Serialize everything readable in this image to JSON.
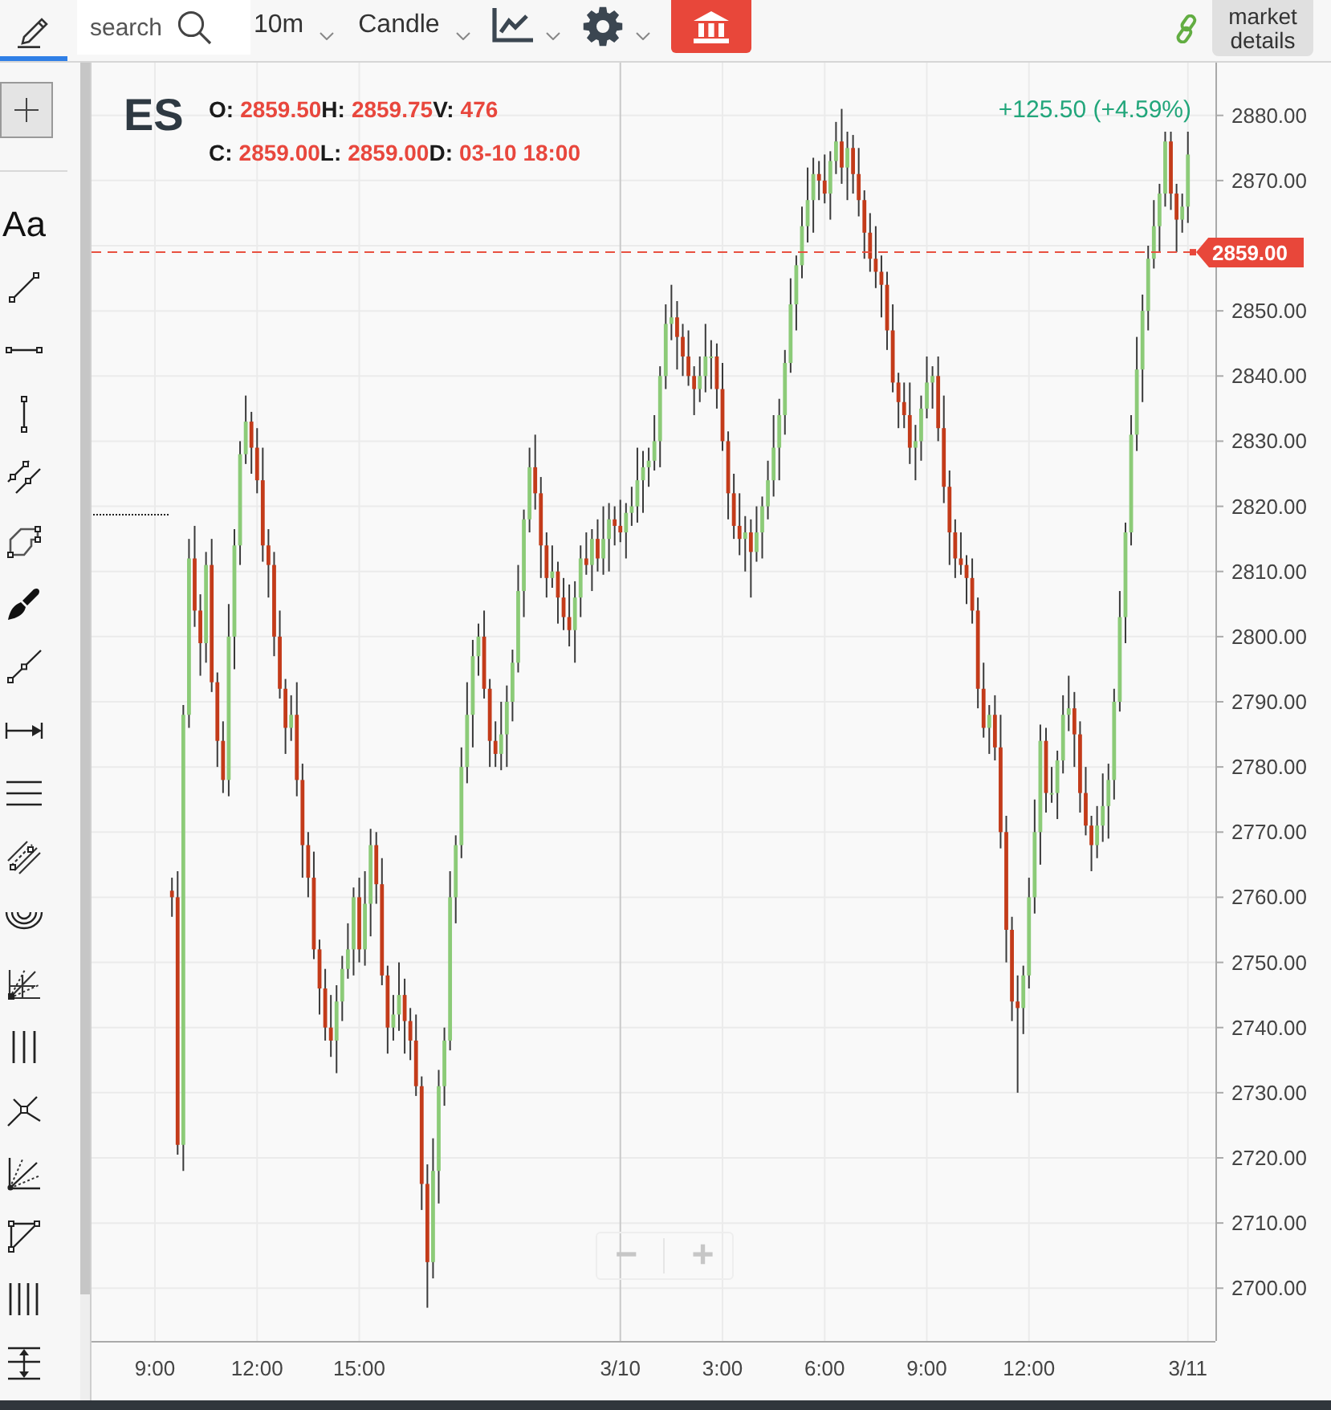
{
  "toolbar": {
    "draw_tab": {
      "selected": true
    },
    "search": {
      "placeholder": "search"
    },
    "interval": {
      "value": "10m"
    },
    "chart_style": {
      "value": "Candle"
    },
    "market_details": {
      "label": "market details"
    }
  },
  "pointer_tools": [
    {
      "kind": "crosshair",
      "selected": true
    }
  ],
  "drawing_tools": [
    {
      "kind": "text",
      "label": "Aa",
      "selected": false
    },
    {
      "kind": "segment",
      "selected": false
    },
    {
      "kind": "horizontal-segment",
      "selected": false
    },
    {
      "kind": "vertical-segment",
      "selected": false
    },
    {
      "kind": "channel",
      "selected": false
    },
    {
      "kind": "polygon",
      "selected": false
    },
    {
      "kind": "brush",
      "selected": false
    },
    {
      "kind": "ray",
      "selected": false
    },
    {
      "kind": "measure",
      "selected": false
    },
    {
      "kind": "horizontal-lines",
      "selected": false
    },
    {
      "kind": "hatched-channel",
      "selected": false
    },
    {
      "kind": "arcs",
      "selected": false
    },
    {
      "kind": "grid",
      "selected": false
    },
    {
      "kind": "three-lines",
      "selected": false
    },
    {
      "kind": "pitchfork",
      "selected": false
    },
    {
      "kind": "fan",
      "selected": false
    },
    {
      "kind": "triangle",
      "selected": false
    },
    {
      "kind": "four-lines",
      "selected": false
    },
    {
      "kind": "range",
      "selected": false
    }
  ],
  "chart": {
    "symbol": "ES",
    "quote_rows": [
      [
        {
          "label": "O:",
          "value": "2859.50"
        },
        {
          "label": "H:",
          "value": "2859.75"
        },
        {
          "label": "V:",
          "value": "476"
        }
      ],
      [
        {
          "label": "C:",
          "value": "2859.00"
        },
        {
          "label": "L:",
          "value": "2859.00"
        },
        {
          "label": "D:",
          "value": "03-10 18:00"
        }
      ]
    ],
    "change": "+125.50 (+4.59%)",
    "chart_data": {
      "type": "candlestick",
      "categories": [
        "9:00",
        null,
        null,
        null,
        null,
        null,
        null,
        null,
        null,
        null,
        null,
        null,
        null,
        null,
        null,
        null,
        null,
        null,
        "12:00",
        null,
        null,
        null,
        null,
        null,
        null,
        null,
        null,
        null,
        null,
        null,
        null,
        null,
        null,
        null,
        null,
        null,
        "15:00",
        null,
        null,
        null,
        null,
        null,
        null,
        null,
        null,
        null,
        null,
        null,
        null,
        null,
        null,
        null,
        null,
        null,
        null,
        null,
        null,
        null,
        null,
        null,
        null,
        null,
        null,
        null,
        null,
        null,
        null,
        null,
        null,
        null,
        null,
        null,
        null,
        null,
        null,
        null,
        null,
        null,
        null,
        null,
        null,
        null,
        "3/10",
        null,
        null,
        null,
        null,
        null,
        null,
        null,
        null,
        null,
        null,
        null,
        null,
        null,
        null,
        null,
        null,
        null,
        "3:00",
        null,
        null,
        null,
        null,
        null,
        null,
        null,
        null,
        null,
        null,
        null,
        null,
        null,
        null,
        null,
        null,
        null,
        "6:00",
        null,
        null,
        null,
        null,
        null,
        null,
        null,
        null,
        null,
        null,
        null,
        null,
        null,
        null,
        null,
        null,
        null,
        "9:00",
        null,
        null,
        null,
        null,
        null,
        null,
        null,
        null,
        null,
        null,
        null,
        null,
        null,
        null,
        null,
        null,
        null,
        "12:00",
        null,
        null,
        null,
        null,
        null,
        null,
        null,
        null,
        null,
        null,
        null,
        null,
        null,
        null,
        null,
        null,
        null,
        null,
        null,
        null,
        null,
        null,
        null,
        null,
        null,
        null,
        null,
        "3/11"
      ],
      "ohlc": [
        null,
        null,
        null,
        [
          2761,
          2763,
          2757,
          2760
        ],
        [
          2760,
          2764,
          2720.5,
          2722
        ],
        [
          2722,
          2789.5,
          2718,
          2788
        ],
        [
          2788,
          2815,
          2786,
          2812
        ],
        [
          2812,
          2817,
          2801.5,
          2804
        ],
        [
          2804,
          2806.5,
          2794,
          2799
        ],
        [
          2799,
          2813,
          2796,
          2811
        ],
        [
          2811,
          2815,
          2791.5,
          2793
        ],
        [
          2793,
          2794.5,
          2780,
          2784
        ],
        [
          2784,
          2787,
          2776,
          2778
        ],
        [
          2778,
          2805,
          2775.5,
          2800
        ],
        [
          2800,
          2816.5,
          2795,
          2814
        ],
        [
          2814,
          2830,
          2811,
          2828
        ],
        [
          2828,
          2837,
          2826.5,
          2833
        ],
        [
          2833,
          2834.5,
          2825,
          2829
        ],
        [
          2829,
          2832,
          2822,
          2824
        ],
        [
          2824,
          2829,
          2811.5,
          2814
        ],
        [
          2814,
          2816.5,
          2806,
          2811
        ],
        [
          2811,
          2813,
          2797,
          2800
        ],
        [
          2800,
          2804,
          2790.5,
          2792
        ],
        [
          2792,
          2793.5,
          2782,
          2786
        ],
        [
          2786,
          2791,
          2784,
          2788
        ],
        [
          2788,
          2793,
          2775.5,
          2778
        ],
        [
          2778,
          2780.5,
          2763,
          2768
        ],
        [
          2768,
          2770,
          2760,
          2763
        ],
        [
          2763,
          2767,
          2750.5,
          2752
        ],
        [
          2752,
          2753.5,
          2742,
          2746
        ],
        [
          2746,
          2749,
          2738,
          2740
        ],
        [
          2740,
          2745,
          2735.5,
          2738
        ],
        [
          2738,
          2746.5,
          2733,
          2744
        ],
        [
          2744,
          2751,
          2741,
          2749
        ],
        [
          2749,
          2756,
          2747.5,
          2752
        ],
        [
          2752,
          2761.5,
          2748,
          2760
        ],
        [
          2760,
          2763,
          2750,
          2752
        ],
        [
          2752,
          2764,
          2749.5,
          2759
        ],
        [
          2759,
          2770.5,
          2754,
          2768
        ],
        [
          2768,
          2770,
          2759,
          2762
        ],
        [
          2762,
          2766,
          2746.5,
          2748
        ],
        [
          2748,
          2749.5,
          2736,
          2740
        ],
        [
          2740,
          2745,
          2738,
          2742
        ],
        [
          2742,
          2750,
          2739.5,
          2745
        ],
        [
          2745,
          2747.5,
          2736,
          2741
        ],
        [
          2741,
          2743,
          2735,
          2738
        ],
        [
          2738,
          2742,
          2729.5,
          2731
        ],
        [
          2731,
          2732.5,
          2712,
          2716
        ],
        [
          2716,
          2719,
          2697,
          2704
        ],
        [
          2704,
          2723,
          2701.5,
          2718
        ],
        [
          2718,
          2733.5,
          2713,
          2731
        ],
        [
          2731,
          2740,
          2728,
          2738
        ],
        [
          2738,
          2764,
          2736.5,
          2760
        ],
        [
          2760,
          2769.5,
          2756,
          2768
        ],
        [
          2768,
          2783,
          2766,
          2780
        ],
        [
          2780,
          2793,
          2777.5,
          2788
        ],
        [
          2788,
          2799.5,
          2783,
          2797
        ],
        [
          2797,
          2802,
          2794,
          2800
        ],
        [
          2800,
          2804,
          2790.5,
          2792
        ],
        [
          2792,
          2793.5,
          2780,
          2784
        ],
        [
          2784,
          2787,
          2780,
          2782
        ],
        [
          2782,
          2790,
          2779.5,
          2785
        ],
        [
          2785,
          2792.5,
          2780,
          2790
        ],
        [
          2790,
          2798,
          2787,
          2796
        ],
        [
          2796,
          2811,
          2794.5,
          2807
        ],
        [
          2807,
          2819.5,
          2803,
          2818
        ],
        [
          2818,
          2829,
          2816,
          2826
        ],
        [
          2826,
          2831,
          2819.5,
          2822
        ],
        [
          2822,
          2824.5,
          2809,
          2814
        ],
        [
          2814,
          2816,
          2806,
          2809
        ],
        [
          2809,
          2814,
          2807.5,
          2810
        ],
        [
          2810,
          2811.5,
          2802,
          2806
        ],
        [
          2806,
          2809,
          2801,
          2803
        ],
        [
          2803,
          2808,
          2798.5,
          2801
        ],
        [
          2801,
          2808.5,
          2796,
          2806
        ],
        [
          2806,
          2814,
          2803,
          2812
        ],
        [
          2812,
          2816,
          2809.5,
          2811
        ],
        [
          2811,
          2816.5,
          2807,
          2815
        ],
        [
          2815,
          2818,
          2810,
          2812
        ],
        [
          2812,
          2820,
          2809.5,
          2815
        ],
        [
          2815,
          2820.5,
          2810,
          2818
        ],
        [
          2818,
          2820,
          2814,
          2817
        ],
        [
          2817,
          2821,
          2814.5,
          2816
        ],
        [
          2816,
          2820.5,
          2812,
          2819
        ],
        [
          2819,
          2823,
          2817,
          2820
        ],
        [
          2820,
          2829,
          2817.5,
          2824
        ],
        [
          2824,
          2828.5,
          2819,
          2826
        ],
        [
          2826,
          2829,
          2823,
          2827
        ],
        [
          2827,
          2834,
          2825.5,
          2830
        ],
        [
          2830,
          2841.5,
          2826,
          2840
        ],
        [
          2840,
          2851,
          2838,
          2848
        ],
        [
          2848,
          2854,
          2845.5,
          2849
        ],
        [
          2849,
          2851.5,
          2841,
          2846
        ],
        [
          2846,
          2848,
          2840,
          2843
        ],
        [
          2843,
          2847,
          2838.5,
          2840
        ],
        [
          2840,
          2841.5,
          2834,
          2838
        ],
        [
          2838,
          2843,
          2836,
          2840
        ],
        [
          2840,
          2848,
          2837.5,
          2843
        ],
        [
          2843,
          2845.5,
          2838,
          2843
        ],
        [
          2843,
          2845,
          2835,
          2838
        ],
        [
          2838,
          2842,
          2828.5,
          2830
        ],
        [
          2830,
          2831.5,
          2818,
          2822
        ],
        [
          2822,
          2825,
          2815,
          2817
        ],
        [
          2817,
          2822,
          2812.5,
          2815
        ],
        [
          2815,
          2818.5,
          2810,
          2816
        ],
        [
          2816,
          2818,
          2806,
          2813
        ],
        [
          2813,
          2820,
          2811.5,
          2816
        ],
        [
          2816,
          2821.5,
          2812,
          2820
        ],
        [
          2820,
          2827,
          2818,
          2824
        ],
        [
          2824,
          2834,
          2821.5,
          2829
        ],
        [
          2829,
          2836.5,
          2824,
          2834
        ],
        [
          2834,
          2844,
          2831,
          2842
        ],
        [
          2842,
          2855,
          2840.5,
          2851
        ],
        [
          2851,
          2858.5,
          2847,
          2857
        ],
        [
          2857,
          2866,
          2855,
          2863
        ],
        [
          2863,
          2872,
          2860.5,
          2867
        ],
        [
          2867,
          2873.5,
          2862,
          2871
        ],
        [
          2871,
          2873,
          2867,
          2870
        ],
        [
          2870,
          2874,
          2866.5,
          2868
        ],
        [
          2868,
          2874.5,
          2864,
          2873
        ],
        [
          2873,
          2879,
          2871,
          2876
        ],
        [
          2876,
          2881,
          2869.5,
          2872
        ],
        [
          2872,
          2877.5,
          2867,
          2875
        ],
        [
          2875,
          2877,
          2868,
          2871
        ],
        [
          2871,
          2875,
          2864.5,
          2867
        ],
        [
          2867,
          2868.5,
          2858,
          2862
        ],
        [
          2862,
          2865,
          2856,
          2858
        ],
        [
          2858,
          2863,
          2853.5,
          2856
        ],
        [
          2856,
          2858.5,
          2849,
          2854
        ],
        [
          2854,
          2856,
          2844,
          2847
        ],
        [
          2847,
          2851,
          2837.5,
          2839
        ],
        [
          2839,
          2840.5,
          2832,
          2836
        ],
        [
          2836,
          2839,
          2832,
          2834
        ],
        [
          2834,
          2839,
          2826.5,
          2829
        ],
        [
          2829,
          2832.5,
          2824,
          2830
        ],
        [
          2830,
          2837,
          2827,
          2835
        ],
        [
          2835,
          2843,
          2833.5,
          2839
        ],
        [
          2839,
          2841.5,
          2835,
          2840
        ],
        [
          2840,
          2843,
          2830,
          2832
        ],
        [
          2832,
          2837,
          2820.5,
          2823
        ],
        [
          2823,
          2825.5,
          2811,
          2816
        ],
        [
          2816,
          2818,
          2809,
          2812
        ],
        [
          2812,
          2816,
          2809.5,
          2811
        ],
        [
          2811,
          2812.5,
          2805,
          2809
        ],
        [
          2809,
          2812,
          2802,
          2804
        ],
        [
          2804,
          2806,
          2789,
          2792
        ],
        [
          2792,
          2796,
          2784.5,
          2786
        ],
        [
          2786,
          2789.5,
          2782,
          2788
        ],
        [
          2788,
          2791,
          2781,
          2783
        ],
        [
          2783,
          2788,
          2767.5,
          2770
        ],
        [
          2770,
          2772.5,
          2750,
          2755
        ],
        [
          2755,
          2757,
          2741,
          2744
        ],
        [
          2744,
          2748,
          2730,
          2743
        ],
        [
          2743,
          2749.5,
          2739,
          2748
        ],
        [
          2748,
          2763,
          2746,
          2760
        ],
        [
          2760,
          2775,
          2757.5,
          2770
        ],
        [
          2770,
          2786.5,
          2765,
          2784
        ],
        [
          2784,
          2786,
          2773,
          2776
        ],
        [
          2776,
          2780,
          2774.5,
          2776
        ],
        [
          2776,
          2782.5,
          2772,
          2781
        ],
        [
          2781,
          2791,
          2779,
          2788
        ],
        [
          2788,
          2794,
          2785.5,
          2789
        ],
        [
          2789,
          2791.5,
          2780,
          2785
        ],
        [
          2785,
          2787,
          2773,
          2776
        ],
        [
          2776,
          2780,
          2769.5,
          2771
        ],
        [
          2771,
          2772.5,
          2764,
          2768
        ],
        [
          2768,
          2774,
          2766,
          2771
        ],
        [
          2771,
          2779,
          2768.5,
          2774
        ],
        [
          2774,
          2780.5,
          2769,
          2778
        ],
        [
          2778,
          2792,
          2775,
          2790
        ],
        [
          2790,
          2807,
          2788.5,
          2803
        ],
        [
          2803,
          2817.5,
          2799,
          2816
        ],
        [
          2816,
          2834,
          2814,
          2831
        ],
        [
          2831,
          2846,
          2828.5,
          2841
        ],
        [
          2841,
          2852.5,
          2836,
          2850
        ],
        [
          2850,
          2860,
          2847,
          2858
        ],
        [
          2858,
          2867,
          2856.5,
          2863
        ],
        [
          2863,
          2869.5,
          2859,
          2868
        ],
        [
          2868,
          2877.5,
          2866,
          2876
        ],
        [
          2876,
          2877.5,
          2865.5,
          2868
        ],
        [
          2868,
          2869.5,
          2859,
          2864
        ],
        [
          2864,
          2868,
          2862,
          2866
        ],
        [
          2866,
          2877.5,
          2863.5,
          2874
        ]
      ],
      "ylim": [
        2691.9,
        2888.1
      ],
      "yticks": [
        {
          "value": 2880,
          "label": "2880.00"
        },
        {
          "value": 2870,
          "label": "2870.00"
        },
        {
          "value": 2850,
          "label": "2850.00"
        },
        {
          "value": 2840,
          "label": "2840.00"
        },
        {
          "value": 2830,
          "label": "2830.00"
        },
        {
          "value": 2820,
          "label": "2820.00"
        },
        {
          "value": 2810,
          "label": "2810.00"
        },
        {
          "value": 2800,
          "label": "2800.00"
        },
        {
          "value": 2790,
          "label": "2790.00"
        },
        {
          "value": 2780,
          "label": "2780.00"
        },
        {
          "value": 2770,
          "label": "2770.00"
        },
        {
          "value": 2760,
          "label": "2760.00"
        },
        {
          "value": 2750,
          "label": "2750.00"
        },
        {
          "value": 2740,
          "label": "2740.00"
        },
        {
          "value": 2730,
          "label": "2730.00"
        },
        {
          "value": 2720,
          "label": "2720.00"
        },
        {
          "value": 2710,
          "label": "2710.00"
        },
        {
          "value": 2700,
          "label": "2700.00"
        }
      ],
      "grid": true,
      "ref_lines": [
        {
          "axis": "y",
          "value": 2859,
          "label": "2859.00"
        }
      ]
    },
    "zoom_buttons": [
      "−",
      "+"
    ]
  }
}
